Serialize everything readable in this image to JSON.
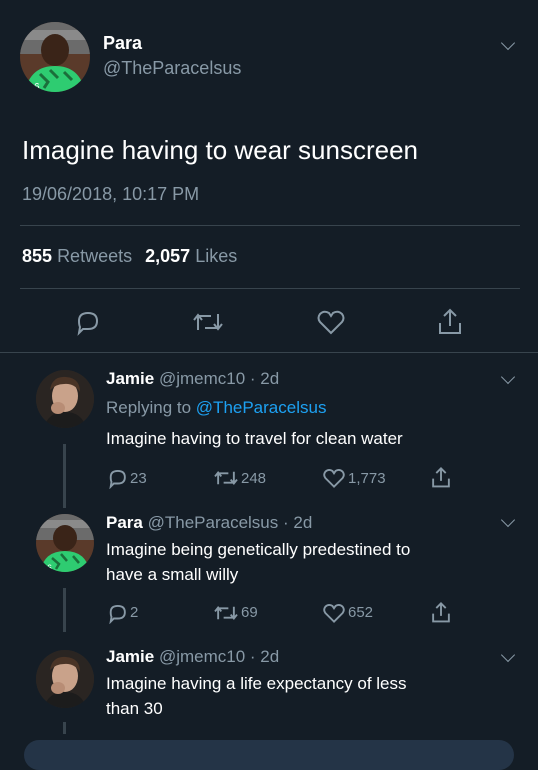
{
  "main_tweet": {
    "name": "Para",
    "handle": "@TheParacelsus",
    "text": "Imagine having to wear sunscreen",
    "timestamp": "19/06/2018, 10:17 PM",
    "retweets_count": "855",
    "retweets_label": "Retweets",
    "likes_count": "2,057",
    "likes_label": "Likes"
  },
  "replies": [
    {
      "name": "Jamie",
      "handle": "@jmemc10",
      "time": "· 2d",
      "replying_prefix": "Replying to",
      "replying_handle": "@TheParacelsus",
      "text": "Imagine having to travel for clean water",
      "reply_count": "23",
      "retweet_count": "248",
      "like_count": "1,773"
    },
    {
      "name": "Para",
      "handle": "@TheParacelsus",
      "time": "· 2d",
      "text_line1": "Imagine being genetically predestined to",
      "text_line2": "have a small willy",
      "reply_count": "2",
      "retweet_count": "69",
      "like_count": "652"
    },
    {
      "name": "Jamie",
      "handle": "@jmemc10",
      "time": "· 2d",
      "text_line1": "Imagine having a life expectancy of less",
      "text_line2": "than 30"
    }
  ],
  "icons": {
    "reply": "reply-icon",
    "retweet": "retweet-icon",
    "like": "heart-icon",
    "share": "share-icon",
    "menu": "chevron-down-icon"
  },
  "colors": {
    "background": "#141d26",
    "muted": "#8899a6",
    "link": "#1da1f2",
    "divider": "#38444d"
  }
}
